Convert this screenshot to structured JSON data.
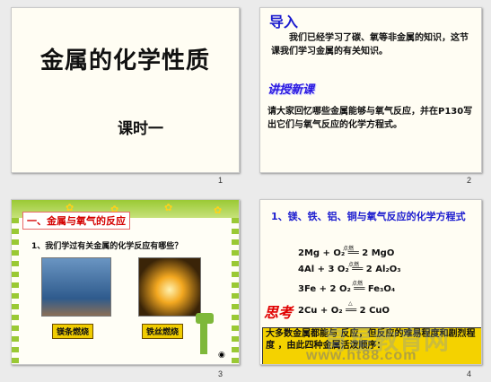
{
  "slides": [
    {
      "number": "1",
      "title": "金属的化学性质",
      "subtitle": "课时一"
    },
    {
      "number": "2",
      "intro_heading": "导入",
      "intro_text": "我们已经学习了碳、氧等非金属的知识，这节课我们学习金属的有关知识。",
      "new_heading": "讲授新课",
      "new_text": "请大家回忆哪些金属能够与氧气反应，并在P130写出它们与氧气反应的化学方程式。"
    },
    {
      "number": "3",
      "heading": "一、金属与氧气的反应",
      "question": "1、我们学过有关金属的化学反应有哪些？",
      "label1": "镁条燃烧",
      "label2": "铁丝燃烧"
    },
    {
      "number": "4",
      "heading": "1、镁、铁、铝、铜与氧气反应的化学方程式",
      "equations": [
        {
          "text": "2Mg  +  O₂  ══ 2 MgO",
          "condition": "点燃"
        },
        {
          "text": "4Al  +  3 O₂ ══ 2 Al₂O₃",
          "condition": "点燃"
        },
        {
          "text": "3Fe  +  2 O₂ ══  Fe₃O₄",
          "condition": "点燃"
        },
        {
          "text": "2Cu  +  O₂  ══ 2 CuO",
          "condition": "△"
        }
      ],
      "think": "思考",
      "conclusion": "大多数金属都能与      反应，但反应的难易程度和剧烈程度      ，由此四种金属活泼顺序："
    }
  ],
  "watermark": "www.ht88.com",
  "watermark2": "育星教育网"
}
